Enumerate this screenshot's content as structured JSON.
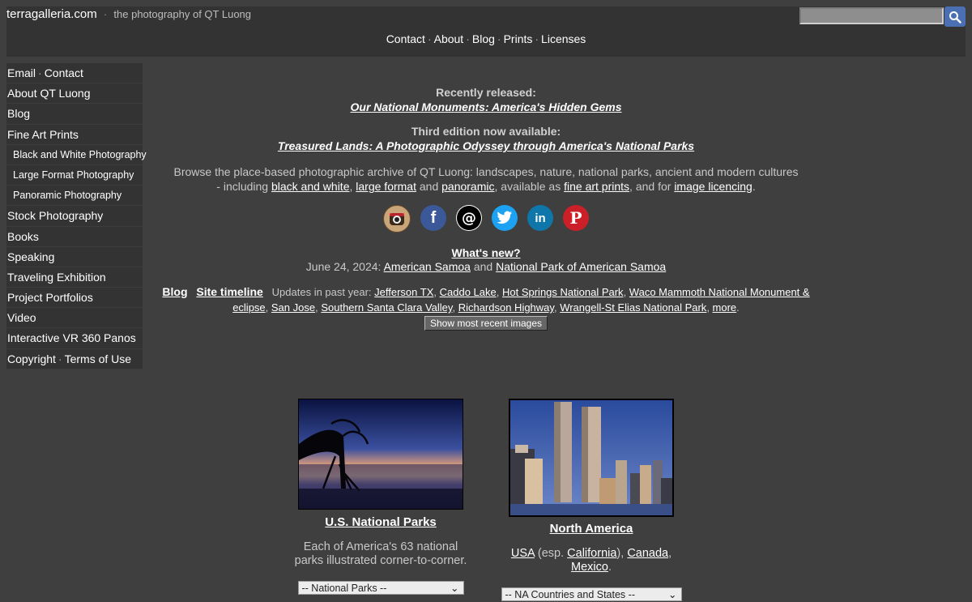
{
  "header": {
    "site_name": "terragalleria.com",
    "separator": "·",
    "tagline": "the photography of QT Luong",
    "search_value": "",
    "nav": [
      "Contact",
      "About",
      "Blog",
      "Prints",
      "Licenses"
    ]
  },
  "sidebar": {
    "items": [
      {
        "label": "Email",
        "label2": "Contact",
        "sub": false
      },
      {
        "label": "About QT Luong",
        "sub": false
      },
      {
        "label": "Blog",
        "sub": false
      },
      {
        "label": "Fine Art Prints",
        "sub": false
      },
      {
        "label": "Black and White Photography",
        "sub": true
      },
      {
        "label": "Large Format Photography",
        "sub": true
      },
      {
        "label": "Panoramic Photography",
        "sub": true
      },
      {
        "label": "Stock Photography",
        "sub": false
      },
      {
        "label": "Books",
        "sub": false
      },
      {
        "label": "Speaking",
        "sub": false
      },
      {
        "label": "Traveling Exhibition",
        "sub": false
      },
      {
        "label": "Project Portfolios",
        "sub": false
      },
      {
        "label": "Video",
        "sub": false
      },
      {
        "label": "Interactive VR 360 Panos",
        "sub": false
      },
      {
        "label": "Copyright",
        "label2": "Terms of Use",
        "sub": false
      }
    ]
  },
  "main": {
    "recent_label": "Recently released:",
    "recent_title": "Our National Monuments: America's Hidden Gems",
    "edition_label": "Third edition now available:",
    "edition_title": "Treasured Lands: A Photographic Odyssey through America's National Parks",
    "intro": {
      "t1": "Browse the place-based photographic archive of QT Luong: landscapes, nature, national parks, ancient and modern cultures - including ",
      "l1": "black and white",
      "t2": ", ",
      "l2": "large format",
      "t3": " and ",
      "l3": "panoramic",
      "t4": ", available as ",
      "l4": "fine art prints",
      "t5": ", and for ",
      "l5": "image licencing",
      "t6": "."
    },
    "social": [
      {
        "name": "instagram",
        "glyph": "◉",
        "color": "#c9a57a"
      },
      {
        "name": "facebook",
        "glyph": "f",
        "color": "#3b5998"
      },
      {
        "name": "threads",
        "glyph": "@",
        "color": "#000000"
      },
      {
        "name": "twitter",
        "glyph": "🐦",
        "color": "#1da1f2"
      },
      {
        "name": "linkedin",
        "glyph": "in",
        "color": "#0e76a8"
      },
      {
        "name": "pinterest",
        "glyph": "P",
        "color": "#cb2027"
      }
    ],
    "whats_new": "What's new?",
    "news_date": "June 24, 2024:",
    "news_link1": "American Samoa",
    "news_and": "and",
    "news_link2": "National Park of American Samoa",
    "blog_link": "Blog",
    "timeline_link": "Site timeline",
    "updates_label": "Updates in past year:",
    "updates": [
      "Jefferson TX",
      "Caddo Lake",
      "Hot Springs National Park",
      "Waco Mammoth National Monument & eclipse",
      "San Jose",
      "Southern Santa Clara Valley",
      "Richardson Highway",
      "Wrangell-St Elias National Park",
      "more"
    ],
    "recent_button": "Show most recent images"
  },
  "cards": {
    "parks": {
      "title": "U.S. National Parks",
      "desc1": "Each of America's 63 national",
      "desc2": "parks illustrated corner-to-corner.",
      "select": "-- National Parks --"
    },
    "na": {
      "title": "North America",
      "l1": "USA",
      "t1": " (esp. ",
      "l2": "California",
      "t2": "), ",
      "l3": "Canada",
      "t3": ",",
      "l4": "Mexico",
      "t4": ".",
      "select": "-- NA Countries and States --"
    }
  }
}
